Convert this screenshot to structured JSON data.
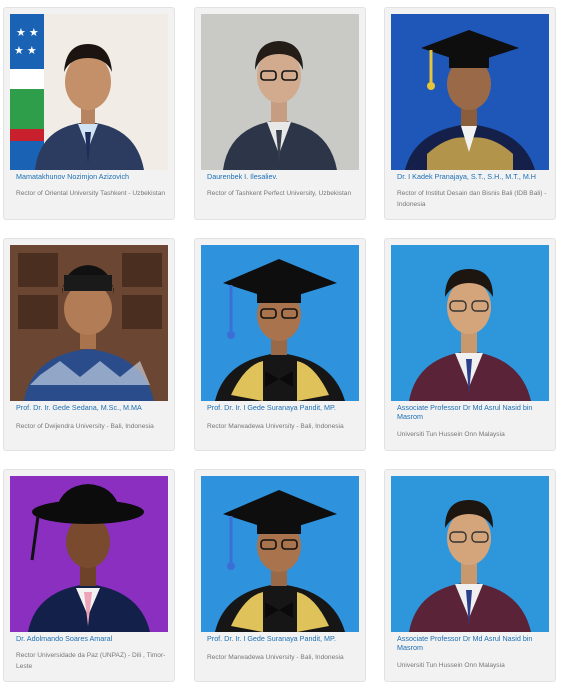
{
  "people": [
    {
      "name": "Mamatakhunov Nozimjon Azizovich",
      "role": "Rector of Oriental University Tashkent - Uzbekistan"
    },
    {
      "name": "Daurenbek I. Ilesaliev.",
      "role": "Rector of Tashkent Perfect University, Uzbekistan"
    },
    {
      "name": "Dr. I Kadek Pranajaya, S.T., S.H., M.T., M.H",
      "role": "Rector of Institut Desain dan Bisnis Bali (IDB Bali) - Indonesia"
    },
    {
      "name": "Prof. Dr. Ir. Gede Sedana, M.Sc., M.MA",
      "role": "Rector of Dwijendra University - Bali, Indonesia"
    },
    {
      "name": "Prof. Dr. Ir. I Gede Suranaya Pandit, MP.",
      "role": "Rector Marwadewa University - Bali, Indonesia"
    },
    {
      "name": "Associate Professor Dr Md Asrul Nasid bin Masrom",
      "role": "Universiti Tun Hussein Onn Malaysia"
    },
    {
      "name": "Dr. Adolmando Soares Amaral",
      "role": "Rector Universidade da Paz (UNPAZ) - Dili , Timor-Leste"
    },
    {
      "name": "Prof. Dr. Ir. I Gede Suranaya Pandit, MP.",
      "role": "Rector Marwadewa University - Bali, Indonesia"
    },
    {
      "name": "Associate Professor Dr Md Asrul Nasid bin Masrom",
      "role": "Universiti Tun Hussein Onn Malaysia"
    }
  ]
}
